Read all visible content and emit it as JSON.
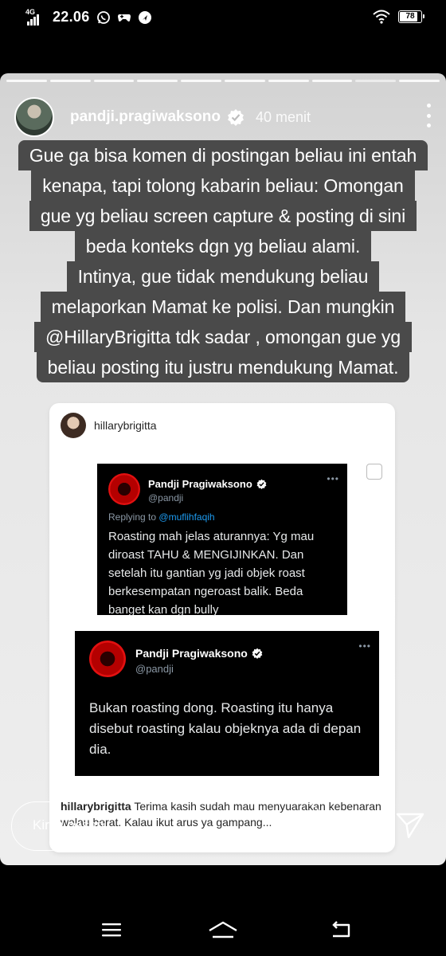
{
  "status_bar": {
    "network": "4G",
    "time": "22.06",
    "battery": "78",
    "icons": [
      "signal-icon",
      "whatsapp-icon",
      "game-controller-icon",
      "location-icon",
      "wifi-icon",
      "battery-icon"
    ]
  },
  "story": {
    "username": "pandji.pragiwaksono",
    "timestamp": "40 menit",
    "segments_total": 10,
    "current_segment": 9,
    "caption_lines": [
      "Gue ga bisa komen di postingan beliau ini  entah",
      "kenapa, tapi tolong kabarin beliau: Omongan",
      "gue yg beliau screen capture & posting di sini",
      "beda konteks dgn yg beliau alami.",
      "Intinya, gue tidak mendukung beliau",
      "melaporkan Mamat ke polisi. Dan mungkin",
      "@HillaryBrigitta tdk sadar , omongan gue yg",
      "beliau posting itu justru mendukung Mamat."
    ]
  },
  "embedded_post": {
    "username": "hillarybrigitta",
    "tweet1": {
      "name": "Pandji Pragiwaksono",
      "handle": "@pandji",
      "replying_prefix": "Replying to",
      "replying_to": "@muflihfaqih",
      "text": "Roasting mah jelas aturannya: Yg mau diroast TAHU & MENGIJINKAN. Dan setelah itu gantian yg jadi objek roast berkesempatan ngeroast balik. Beda banget kan dgn bully"
    },
    "tweet2": {
      "name": "Pandji Pragiwaksono",
      "handle": "@pandji",
      "text": "Bukan roasting dong. Roasting itu hanya disebut roasting kalau objeknya ada di depan dia."
    },
    "caption_user": "hillarybrigitta",
    "caption_text": "Terima kasih sudah mau menyuarakan kebenaran walau berat. Kalau ikut arus ya gampang..."
  },
  "reply": {
    "placeholder": "Kirim pesan"
  },
  "colors": {
    "caption_bg": "#4a4a4a",
    "story_bg": "#e4e4e4",
    "tweet_bg": "#000000",
    "link_blue": "#1d9bf0",
    "verified_blue": "#1d9bf0"
  },
  "nav": {
    "buttons": [
      "menu-icon",
      "home-icon",
      "back-icon"
    ]
  }
}
